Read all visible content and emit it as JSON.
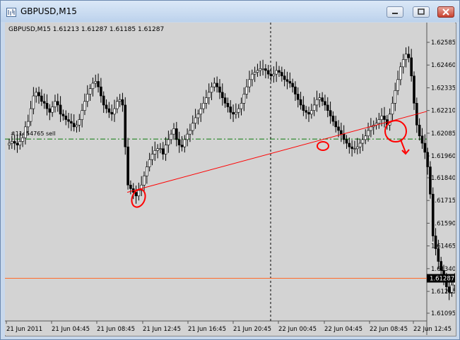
{
  "window": {
    "title": "GBPUSD,M15",
    "buttons": [
      "minimize",
      "restore",
      "close"
    ]
  },
  "chart_data": {
    "type": "candlestick",
    "symbol_header": "GBPUSD,M15  1.61213 1.61287 1.61185 1.61287",
    "y_ticks": [
      "1.62585",
      "1.62460",
      "1.62335",
      "1.62210",
      "1.62085",
      "1.61960",
      "1.61840",
      "1.61715",
      "1.61590",
      "1.61465",
      "1.61340",
      "1.61215",
      "1.61095"
    ],
    "y_tick_values": [
      1.62585,
      1.6246,
      1.62335,
      1.6221,
      1.62085,
      1.6196,
      1.6184,
      1.61715,
      1.6159,
      1.61465,
      1.6134,
      1.61215,
      1.61095
    ],
    "ylim": [
      1.61095,
      1.62585
    ],
    "x_ticks": [
      "21 Jun 2011",
      "21 Jun 04:45",
      "21 Jun 08:45",
      "21 Jun 12:45",
      "21 Jun 16:45",
      "21 Jun 20:45",
      "22 Jun 00:45",
      "22 Jun 04:45",
      "22 Jun 08:45",
      "22 Jun 12:45"
    ],
    "current_price": "1.61287",
    "current_price_value": 1.61287,
    "order_level_value": 1.62053,
    "order_label": "#11454765 sell",
    "trendline": {
      "from": {
        "bar": 44,
        "price": 1.6176
      },
      "to": {
        "bar": 150,
        "price": 1.62185
      }
    },
    "closes": [
      1.6203,
      1.6204,
      1.6203,
      1.6202,
      1.6204,
      1.6206,
      1.6212,
      1.6215,
      1.6222,
      1.6229,
      1.6231,
      1.6229,
      1.6226,
      1.6225,
      1.6222,
      1.622,
      1.6223,
      1.6226,
      1.6224,
      1.6219,
      1.6218,
      1.6216,
      1.6215,
      1.6214,
      1.6212,
      1.6213,
      1.6216,
      1.6221,
      1.6226,
      1.623,
      1.6233,
      1.6236,
      1.6237,
      1.6234,
      1.6229,
      1.6224,
      1.6222,
      1.622,
      1.6219,
      1.6222,
      1.6226,
      1.6227,
      1.6224,
      1.6201,
      1.618,
      1.6178,
      1.6176,
      1.6174,
      1.6177,
      1.618,
      1.6185,
      1.619,
      1.6194,
      1.6197,
      1.6199,
      1.62,
      1.62,
      1.6197,
      1.6202,
      1.6205,
      1.6208,
      1.6211,
      1.6205,
      1.6202,
      1.6201,
      1.6205,
      1.6208,
      1.621,
      1.6214,
      1.6217,
      1.6219,
      1.6222,
      1.6225,
      1.6228,
      1.6231,
      1.6234,
      1.6236,
      1.6234,
      1.6231,
      1.6228,
      1.6225,
      1.6223,
      1.622,
      1.6219,
      1.622,
      1.6222,
      1.6225,
      1.623,
      1.6234,
      1.6238,
      1.6241,
      1.6242,
      1.6243,
      1.6244,
      1.6244,
      1.6243,
      1.6241,
      1.624,
      1.6241,
      1.6243,
      1.6242,
      1.624,
      1.6238,
      1.6237,
      1.6236,
      1.6234,
      1.623,
      1.6227,
      1.6224,
      1.6221,
      1.622,
      1.6219,
      1.6221,
      1.6224,
      1.6227,
      1.6228,
      1.6226,
      1.6224,
      1.6221,
      1.6218,
      1.6215,
      1.6212,
      1.621,
      1.6208,
      1.6205,
      1.6203,
      1.6201,
      1.62,
      1.62,
      1.6201,
      1.6203,
      1.6205,
      1.6207,
      1.621,
      1.6212,
      1.6213,
      1.6214,
      1.6216,
      1.6218,
      1.6216,
      1.6213,
      1.6219,
      1.6225,
      1.6232,
      1.6238,
      1.6245,
      1.6249,
      1.6252,
      1.625,
      1.624,
      1.6225,
      1.6213,
      1.6207,
      1.6203,
      1.6198,
      1.619,
      1.6175,
      1.6152,
      1.6145,
      1.6138,
      1.6133,
      1.6128,
      1.6124,
      1.6121,
      1.6125,
      1.6129
    ]
  }
}
